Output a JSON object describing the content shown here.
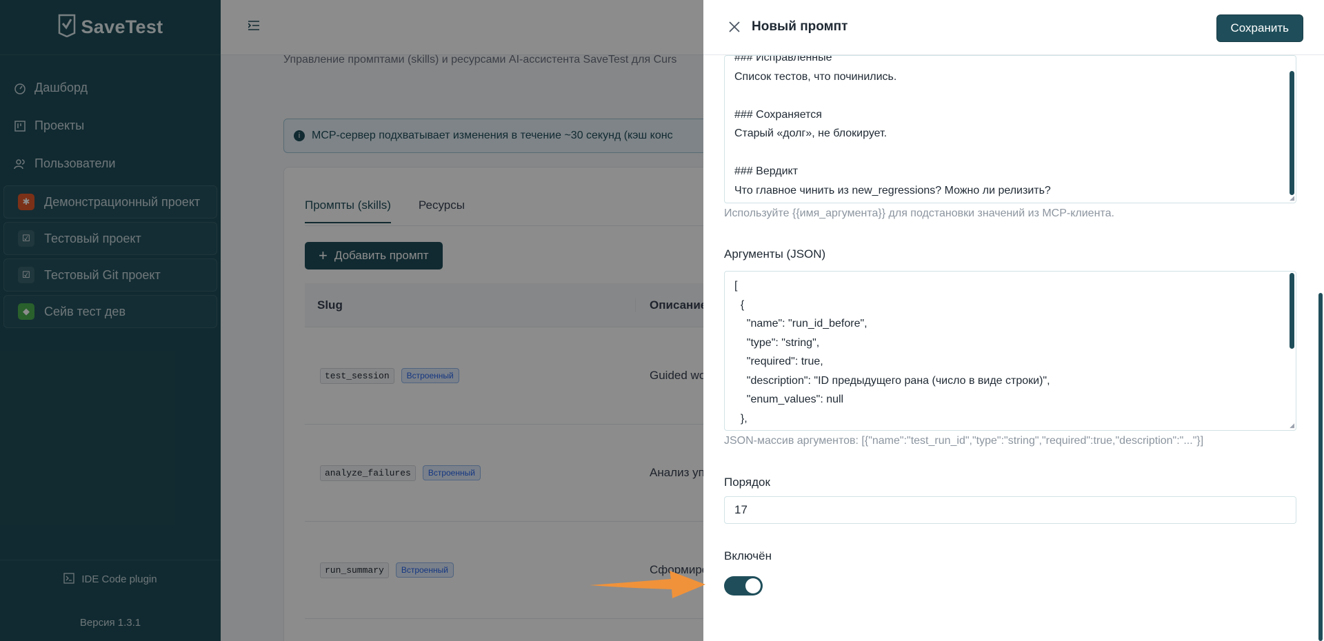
{
  "sidebar": {
    "logo": "SaveTest",
    "nav": [
      {
        "label": "Дашборд",
        "icon": "dashboard-icon"
      },
      {
        "label": "Проекты",
        "icon": "kanban-icon"
      },
      {
        "label": "Пользователи",
        "icon": "users-icon"
      }
    ],
    "projects": [
      {
        "label": "Демонстрационный проект",
        "icon": "bug-icon",
        "color": "#e05a2b"
      },
      {
        "label": "Тестовый проект",
        "icon": "clipboard-check-icon",
        "color": "#3a6470"
      },
      {
        "label": "Тестовый Git проект",
        "icon": "clipboard-check-icon",
        "color": "#3a6470"
      },
      {
        "label": "Сейв тест дев",
        "icon": "android-icon",
        "color": "#4caf50"
      }
    ],
    "footer_link": "IDE Code plugin",
    "version": "Версия 1.3.1"
  },
  "main": {
    "subtitle": "Управление промптами (skills) и ресурсами AI-ассистента SaveTest для Curs",
    "banner": "MCP-сервер подхватывает изменения в течение ~30 секунд (кэш конс",
    "tabs": [
      "Промпты (skills)",
      "Ресурсы"
    ],
    "add_button": "Добавить промпт",
    "table": {
      "headers": [
        "Slug",
        "Описание"
      ],
      "rows": [
        {
          "slug": "test_session",
          "badge": "Встроенный",
          "desc": "Guided wo"
        },
        {
          "slug": "analyze_failures",
          "badge": "Встроенный",
          "desc": "Анализ уп"
        },
        {
          "slug": "run_summary",
          "badge": "Встроенный",
          "desc": "Сформиро"
        }
      ]
    }
  },
  "drawer": {
    "title": "Новый промпт",
    "save_label": "Сохранить",
    "template_text": "### Исправленные\nСписок тестов, что починились.\n\n### Сохраняется\nСтарый «долг», не блокирует.\n\n### Вердикт\nЧто главное чинить из new_regressions? Можно ли релизить?",
    "template_hint": "Используйте {{имя_аргумента}} для подстановки значений из MCP-клиента.",
    "args_label": "Аргументы (JSON)",
    "args_text": "[\n  {\n    \"name\": \"run_id_before\",\n    \"type\": \"string\",\n    \"required\": true,\n    \"description\": \"ID предыдущего рана (число в виде строки)\",\n    \"enum_values\": null\n  },",
    "args_hint": "JSON-массив аргументов: [{\"name\":\"test_run_id\",\"type\":\"string\",\"required\":true,\"description\":\"...\"}]",
    "order_label": "Порядок",
    "order_value": "17",
    "enabled_label": "Включён",
    "enabled": true
  },
  "colors": {
    "primary": "#1f4e5a",
    "arrow": "#f0923a"
  }
}
